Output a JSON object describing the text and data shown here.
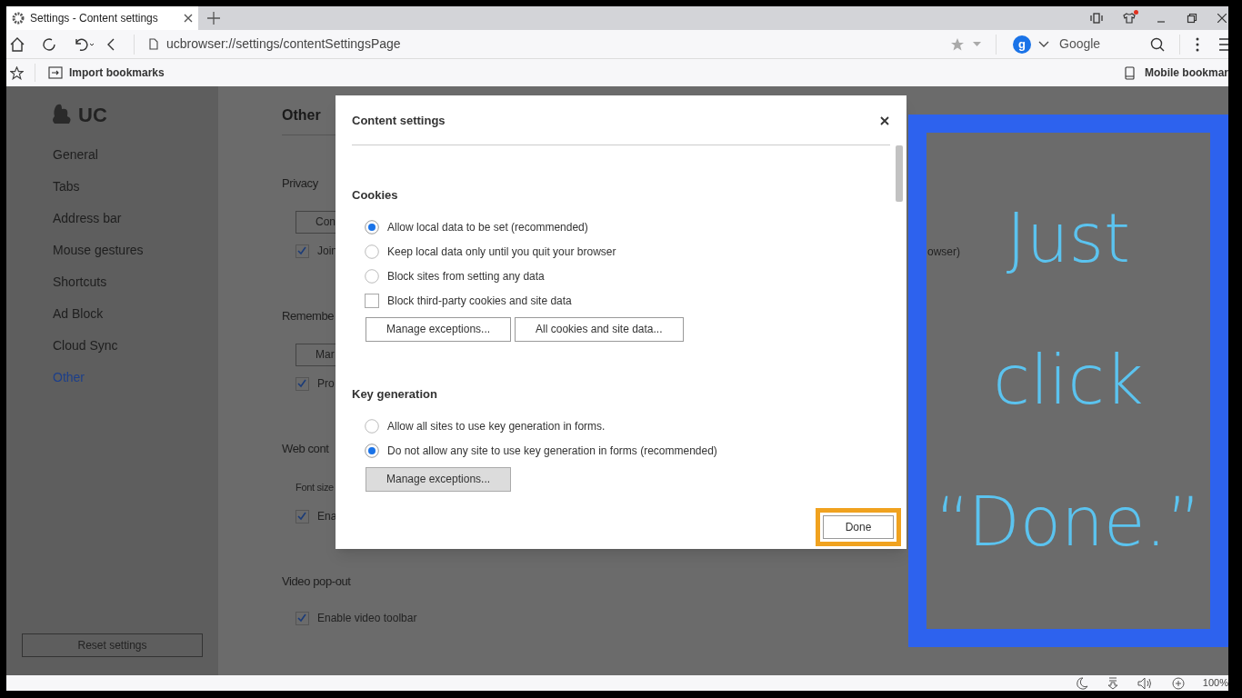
{
  "browser_tab": {
    "title": "Settings - Content settings"
  },
  "address_bar": {
    "url": "ucbrowser://settings/contentSettingsPage"
  },
  "search_box": {
    "engine_letter": "g",
    "engine": "Google"
  },
  "bookmarks_bar": {
    "import_label": "Import bookmarks",
    "mobile_label": "Mobile bookmar"
  },
  "sidebar": {
    "logo": "UC",
    "items": [
      {
        "label": "General",
        "selected": false
      },
      {
        "label": "Tabs",
        "selected": false
      },
      {
        "label": "Address bar",
        "selected": false
      },
      {
        "label": "Mouse gestures",
        "selected": false
      },
      {
        "label": "Shortcuts",
        "selected": false
      },
      {
        "label": "Ad Block",
        "selected": false
      },
      {
        "label": "Cloud Sync",
        "selected": false
      },
      {
        "label": "Other",
        "selected": true
      }
    ],
    "reset_button": "Reset settings"
  },
  "page": {
    "title": "Other",
    "items": [
      {
        "kind": "heading",
        "label": "Privacy"
      },
      {
        "kind": "button",
        "label": "Con"
      },
      {
        "kind": "checkbox",
        "label": "Join",
        "checked": true,
        "trailing": "owser)"
      },
      {
        "kind": "heading",
        "label": "Remembe"
      },
      {
        "kind": "button",
        "label": "Mar"
      },
      {
        "kind": "checkbox",
        "label": "Pro",
        "checked": true
      },
      {
        "kind": "heading",
        "label": "Web cont"
      },
      {
        "kind": "label",
        "label": "Font size"
      },
      {
        "kind": "checkbox",
        "label": "Ena",
        "checked": true
      },
      {
        "kind": "heading",
        "label": "Video pop-out"
      },
      {
        "kind": "checkbox",
        "label": "Enable video toolbar",
        "checked": true
      }
    ]
  },
  "dialog": {
    "title": "Content settings",
    "sections": [
      {
        "title": "Cookies",
        "options": [
          {
            "kind": "radio",
            "label": "Allow local data to be set (recommended)",
            "selected": true
          },
          {
            "kind": "radio",
            "label": "Keep local data only until you quit your browser",
            "selected": false
          },
          {
            "kind": "radio",
            "label": "Block sites from setting any data",
            "selected": false
          },
          {
            "kind": "checkbox",
            "label": "Block third-party cookies and site data",
            "checked": false
          }
        ],
        "buttons": [
          {
            "label": "Manage exceptions...",
            "hovered": false
          },
          {
            "label": "All cookies and site data...",
            "hovered": false
          }
        ]
      },
      {
        "title": "Key generation",
        "options": [
          {
            "kind": "radio",
            "label": "Allow all sites to use key generation in forms.",
            "selected": false
          },
          {
            "kind": "radio",
            "label": "Do not allow any site to use key generation in forms (recommended)",
            "selected": true
          }
        ],
        "buttons": [
          {
            "label": "Manage exceptions...",
            "hovered": true
          }
        ]
      }
    ],
    "done_button": "Done"
  },
  "annotation": {
    "lines": [
      "Just",
      "click",
      "“Done.”"
    ]
  },
  "status_bar": {
    "zoom": "100%"
  }
}
